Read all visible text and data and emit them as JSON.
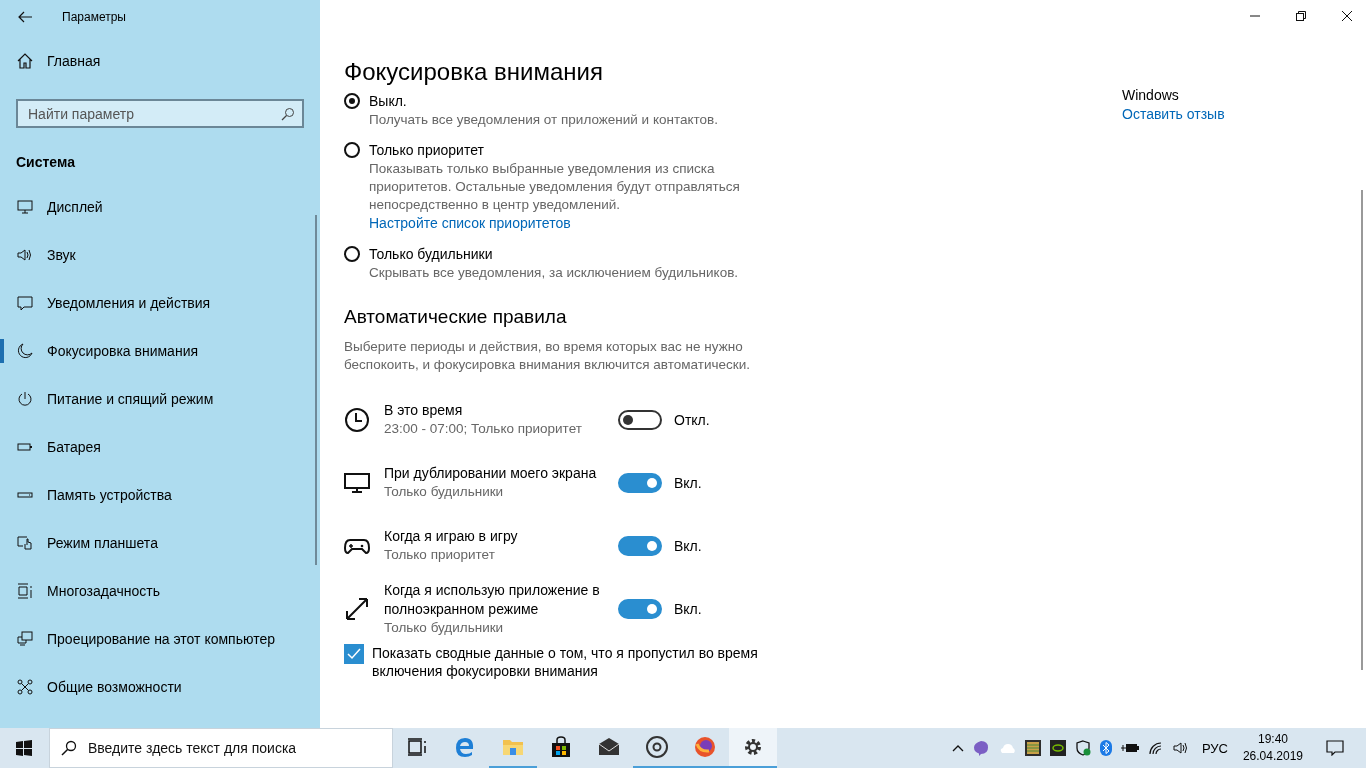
{
  "window": {
    "title": "Параметры"
  },
  "sidebar": {
    "home": "Главная",
    "search": {
      "placeholder": "Найти параметр"
    },
    "section": "Система",
    "items": [
      {
        "label": "Дисплей",
        "selected": false
      },
      {
        "label": "Звук",
        "selected": false
      },
      {
        "label": "Уведомления и действия",
        "selected": false
      },
      {
        "label": "Фокусировка внимания",
        "selected": true
      },
      {
        "label": "Питание и спящий режим",
        "selected": false
      },
      {
        "label": "Батарея",
        "selected": false
      },
      {
        "label": "Память устройства",
        "selected": false
      },
      {
        "label": "Режим планшета",
        "selected": false
      },
      {
        "label": "Многозадачность",
        "selected": false
      },
      {
        "label": "Проецирование на этот компьютер",
        "selected": false
      },
      {
        "label": "Общие возможности",
        "selected": false
      }
    ]
  },
  "content": {
    "title": "Фокусировка внимания",
    "options": [
      {
        "label": "Выкл.",
        "description": "Получать все уведомления от приложений и контактов.",
        "selected": true
      },
      {
        "label": "Только приоритет",
        "description": "Показывать только выбранные уведомления из списка приоритетов. Остальные уведомления будут отправляться непосредственно в центр уведомлений.",
        "link": "Настройте список приоритетов",
        "selected": false
      },
      {
        "label": "Только будильники",
        "description": "Скрывать все уведомления, за исключением будильников.",
        "selected": false
      }
    ],
    "rules_title": "Автоматические правила",
    "rules_description": "Выберите периоды и действия, во время которых вас не нужно беспокоить, и фокусировка внимания включится автоматически.",
    "rules": [
      {
        "title": "В это время",
        "subtitle": "23:00 - 07:00; Только приоритет",
        "on": false,
        "state": "Откл."
      },
      {
        "title": "При дублировании моего экрана",
        "subtitle": "Только будильники",
        "on": true,
        "state": "Вкл."
      },
      {
        "title": "Когда я играю в игру",
        "subtitle": "Только приоритет",
        "on": true,
        "state": "Вкл."
      },
      {
        "title": "Когда я использую приложение в полноэкранном режиме",
        "subtitle": "Только будильники",
        "on": true,
        "state": "Вкл."
      }
    ],
    "summary": {
      "label": "Показать сводные данные о том, что я пропустил во время включения фокусировки внимания",
      "checked": true
    }
  },
  "aside": {
    "heading": "Windows",
    "link": "Оставить отзыв"
  },
  "taskbar": {
    "search": {
      "placeholder": "Введите здесь текст для поиска"
    },
    "apps": [
      {
        "running": false,
        "selected": false
      },
      {
        "running": false,
        "selected": false
      },
      {
        "running": true,
        "selected": false
      },
      {
        "running": false,
        "selected": false
      },
      {
        "running": false,
        "selected": false
      },
      {
        "running": true,
        "selected": false
      },
      {
        "running": true,
        "selected": false
      },
      {
        "running": true,
        "selected": true
      }
    ],
    "language": "РУС",
    "time": "19:40",
    "date": "26.04.2019"
  }
}
